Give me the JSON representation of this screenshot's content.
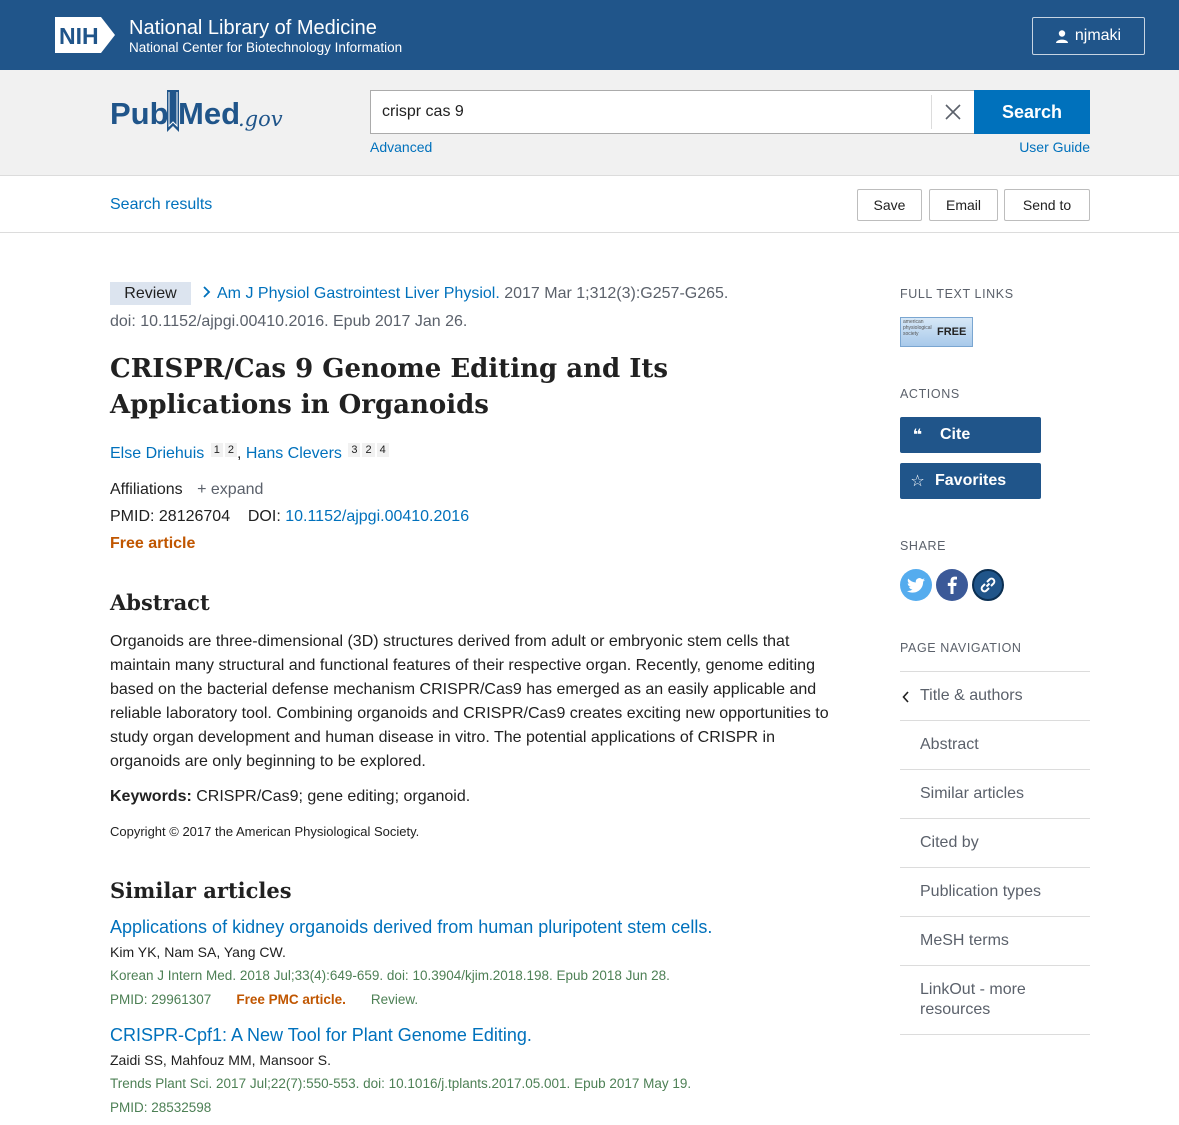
{
  "header": {
    "nih_badge": "NIH",
    "org_title": "National Library of Medicine",
    "org_subtitle": "National Center for Biotechnology Information",
    "user_name": "njmaki"
  },
  "search": {
    "logo_text_pub": "Pub",
    "logo_text_med": "Med",
    "logo_text_gov": ".gov",
    "query": "crispr cas 9",
    "button_label": "Search",
    "advanced_label": "Advanced",
    "user_guide_label": "User Guide"
  },
  "toolbar": {
    "search_results_label": "Search results",
    "save_label": "Save",
    "email_label": "Email",
    "send_to_label": "Send to"
  },
  "article": {
    "type_badge": "Review",
    "journal": "Am J Physiol Gastrointest Liver Physiol.",
    "citation": "2017 Mar 1;312(3):G257-G265.",
    "doi_epub": "doi: 10.1152/ajpgi.00410.2016. Epub 2017 Jan 26.",
    "title": "CRISPR/Cas 9 Genome Editing and Its Applications in Organoids",
    "authors": [
      {
        "name": "Else Driehuis",
        "affils": [
          "1",
          "2"
        ]
      },
      {
        "name": "Hans Clevers",
        "affils": [
          "3",
          "2",
          "4"
        ]
      }
    ],
    "affiliations_label": "Affiliations",
    "expand_label": "expand",
    "pmid_label": "PMID:",
    "pmid": "28126704",
    "doi_label": "DOI:",
    "doi": "10.1152/ajpgi.00410.2016",
    "free_label": "Free article",
    "abstract_heading": "Abstract",
    "abstract": "Organoids are three-dimensional (3D) structures derived from adult or embryonic stem cells that maintain many structural and functional features of their respective organ. Recently, genome editing based on the bacterial defense mechanism CRISPR/Cas9 has emerged as an easily applicable and reliable laboratory tool. Combining organoids and CRISPR/Cas9 creates exciting new opportunities to study organ development and human disease in vitro. The potential applications of CRISPR in organoids are only beginning to be explored.",
    "keywords_label": "Keywords:",
    "keywords": "CRISPR/Cas9; gene editing; organoid.",
    "copyright": "Copyright © 2017 the American Physiological Society."
  },
  "similar": {
    "heading": "Similar articles",
    "items": [
      {
        "title": "Applications of kidney organoids derived from human pluripotent stem cells.",
        "authors": "Kim YK, Nam SA, Yang CW.",
        "citation": "Korean J Intern Med. 2018 Jul;33(4):649-659. doi: 10.3904/kjim.2018.198. Epub 2018 Jun 28.",
        "pmid": "PMID: 29961307",
        "free": "Free PMC article.",
        "type": "Review."
      },
      {
        "title": "CRISPR-Cpf1: A New Tool for Plant Genome Editing.",
        "authors": "Zaidi SS, Mahfouz MM, Mansoor S.",
        "citation": "Trends Plant Sci. 2017 Jul;22(7):550-553. doi: 10.1016/j.tplants.2017.05.001. Epub 2017 May 19.",
        "pmid": "PMID: 28532598"
      }
    ]
  },
  "sidebar": {
    "full_text_label": "Full text links",
    "free_badge": "FREE",
    "publisher_mini": "american physiological society",
    "actions_label": "Actions",
    "cite_label": "Cite",
    "favorites_label": "Favorites",
    "share_label": "Share",
    "page_nav_label": "Page navigation",
    "nav_items": [
      "Title & authors",
      "Abstract",
      "Similar articles",
      "Cited by",
      "Publication types",
      "MeSH terms",
      "LinkOut - more resources"
    ]
  },
  "colors": {
    "nih_blue": "#20558a",
    "link_blue": "#0071bc",
    "free_orange": "#c05600",
    "citation_green": "#4d8055"
  }
}
